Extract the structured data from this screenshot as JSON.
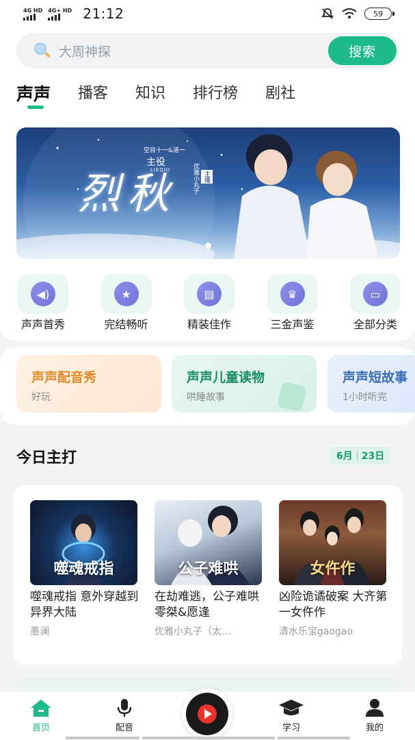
{
  "status_bar": {
    "net1": "4G HD",
    "net2": "4G+ HD",
    "time": "21:12",
    "battery": "59"
  },
  "search": {
    "placeholder": "大周神探",
    "button": "搜索"
  },
  "tabs": [
    "声声",
    "播客",
    "知识",
    "排行榜",
    "剧社"
  ],
  "banner": {
    "title": "烈秋",
    "pinyin": "LIEQIU",
    "credit_line": "空目十一&道一",
    "role": "主役",
    "host_tag": "主播",
    "host_name": "优雅小丸子"
  },
  "categories": [
    {
      "label": "声声首秀",
      "icon": "speaker-icon"
    },
    {
      "label": "完结畅听",
      "icon": "planet-icon"
    },
    {
      "label": "精装佳作",
      "icon": "book-icon"
    },
    {
      "label": "三金声鉴",
      "icon": "award-icon"
    },
    {
      "label": "全部分类",
      "icon": "folder-icon"
    }
  ],
  "promos": [
    {
      "title": "声声配音秀",
      "subtitle": "好玩"
    },
    {
      "title": "声声儿童读物",
      "subtitle": "哄睡故事"
    },
    {
      "title": "声声短故事",
      "subtitle": "1小时听完"
    }
  ],
  "today": {
    "title": "今日主打",
    "date_month": "6月",
    "date_day": "23日",
    "books": [
      {
        "cover_title": "噬魂戒指",
        "title": "噬魂戒指 意外穿越到异界大陆",
        "author": "墨澜"
      },
      {
        "cover_title": "公子难哄",
        "title": "在劫难逃，公子难哄 零桀&愿逢",
        "author": "优雅小丸子（太…"
      },
      {
        "cover_title": "女仵作",
        "title": "凶险诡谲破案 大齐第一女仵作",
        "author": "清水乐宝gaogao"
      }
    ]
  },
  "bottom_nav": [
    {
      "label": "首页",
      "icon": "home-icon",
      "active": true
    },
    {
      "label": "配音",
      "icon": "microphone-icon"
    },
    {
      "label": "学习",
      "icon": "graduation-cap-icon"
    },
    {
      "label": "我的",
      "icon": "person-icon"
    }
  ],
  "colors": {
    "accent": "#1dba8a",
    "background": "#f2f4f6"
  }
}
